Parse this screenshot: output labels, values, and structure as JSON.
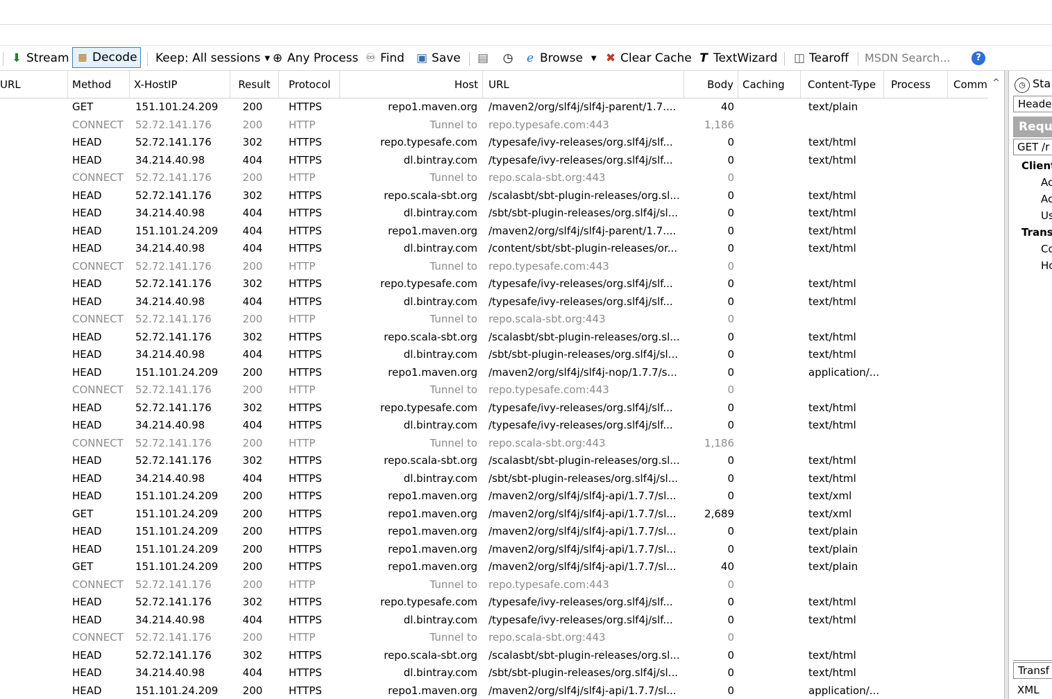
{
  "toolbar": {
    "stream": "Stream",
    "decode": "Decode",
    "keep": "Keep: All sessions",
    "any_process": "Any Process",
    "find": "Find",
    "save": "Save",
    "browse": "Browse",
    "clear_cache": "Clear Cache",
    "textwizard": "TextWizard",
    "tearoff": "Tearoff",
    "msdn_search": "MSDN Search..."
  },
  "columns": {
    "url_left": "URL",
    "method": "Method",
    "xhostip": "X-HostIP",
    "result": "Result",
    "protocol": "Protocol",
    "host": "Host",
    "url": "URL",
    "body": "Body",
    "caching": "Caching",
    "content_type": "Content-Type",
    "process": "Process",
    "comments": "Comm"
  },
  "rows": [
    {
      "method": "GET",
      "xhost": "151.101.24.209",
      "result": "200",
      "protocol": "HTTPS",
      "host": "repo1.maven.org",
      "url": "/maven2/org/slf4j/slf4j-parent/1.7....",
      "body": "40",
      "ctype": "text/plain",
      "tunnel": false
    },
    {
      "method": "CONNECT",
      "xhost": "52.72.141.176",
      "result": "200",
      "protocol": "HTTP",
      "host": "Tunnel to",
      "url": "repo.typesafe.com:443",
      "body": "1,186",
      "ctype": "",
      "tunnel": true
    },
    {
      "method": "HEAD",
      "xhost": "52.72.141.176",
      "result": "302",
      "protocol": "HTTPS",
      "host": "repo.typesafe.com",
      "url": "/typesafe/ivy-releases/org.slf4j/slf...",
      "body": "0",
      "ctype": "text/html",
      "tunnel": false
    },
    {
      "method": "HEAD",
      "xhost": "34.214.40.98",
      "result": "404",
      "protocol": "HTTPS",
      "host": "dl.bintray.com",
      "url": "/typesafe/ivy-releases/org.slf4j/slf...",
      "body": "0",
      "ctype": "text/html",
      "tunnel": false
    },
    {
      "method": "CONNECT",
      "xhost": "52.72.141.176",
      "result": "200",
      "protocol": "HTTP",
      "host": "Tunnel to",
      "url": "repo.scala-sbt.org:443",
      "body": "0",
      "ctype": "",
      "tunnel": true
    },
    {
      "method": "HEAD",
      "xhost": "52.72.141.176",
      "result": "302",
      "protocol": "HTTPS",
      "host": "repo.scala-sbt.org",
      "url": "/scalasbt/sbt-plugin-releases/org.sl...",
      "body": "0",
      "ctype": "text/html",
      "tunnel": false
    },
    {
      "method": "HEAD",
      "xhost": "34.214.40.98",
      "result": "404",
      "protocol": "HTTPS",
      "host": "dl.bintray.com",
      "url": "/sbt/sbt-plugin-releases/org.slf4j/sl...",
      "body": "0",
      "ctype": "text/html",
      "tunnel": false
    },
    {
      "method": "HEAD",
      "xhost": "151.101.24.209",
      "result": "404",
      "protocol": "HTTPS",
      "host": "repo1.maven.org",
      "url": "/maven2/org/slf4j/slf4j-parent/1.7....",
      "body": "0",
      "ctype": "text/html",
      "tunnel": false
    },
    {
      "method": "HEAD",
      "xhost": "34.214.40.98",
      "result": "404",
      "protocol": "HTTPS",
      "host": "dl.bintray.com",
      "url": "/content/sbt/sbt-plugin-releases/or...",
      "body": "0",
      "ctype": "text/html",
      "tunnel": false
    },
    {
      "method": "CONNECT",
      "xhost": "52.72.141.176",
      "result": "200",
      "protocol": "HTTP",
      "host": "Tunnel to",
      "url": "repo.typesafe.com:443",
      "body": "0",
      "ctype": "",
      "tunnel": true
    },
    {
      "method": "HEAD",
      "xhost": "52.72.141.176",
      "result": "302",
      "protocol": "HTTPS",
      "host": "repo.typesafe.com",
      "url": "/typesafe/ivy-releases/org.slf4j/slf...",
      "body": "0",
      "ctype": "text/html",
      "tunnel": false
    },
    {
      "method": "HEAD",
      "xhost": "34.214.40.98",
      "result": "404",
      "protocol": "HTTPS",
      "host": "dl.bintray.com",
      "url": "/typesafe/ivy-releases/org.slf4j/slf...",
      "body": "0",
      "ctype": "text/html",
      "tunnel": false
    },
    {
      "method": "CONNECT",
      "xhost": "52.72.141.176",
      "result": "200",
      "protocol": "HTTP",
      "host": "Tunnel to",
      "url": "repo.scala-sbt.org:443",
      "body": "0",
      "ctype": "",
      "tunnel": true
    },
    {
      "method": "HEAD",
      "xhost": "52.72.141.176",
      "result": "302",
      "protocol": "HTTPS",
      "host": "repo.scala-sbt.org",
      "url": "/scalasbt/sbt-plugin-releases/org.sl...",
      "body": "0",
      "ctype": "text/html",
      "tunnel": false
    },
    {
      "method": "HEAD",
      "xhost": "34.214.40.98",
      "result": "404",
      "protocol": "HTTPS",
      "host": "dl.bintray.com",
      "url": "/sbt/sbt-plugin-releases/org.slf4j/sl...",
      "body": "0",
      "ctype": "text/html",
      "tunnel": false
    },
    {
      "method": "HEAD",
      "xhost": "151.101.24.209",
      "result": "200",
      "protocol": "HTTPS",
      "host": "repo1.maven.org",
      "url": "/maven2/org/slf4j/slf4j-nop/1.7.7/s...",
      "body": "0",
      "ctype": "application/...",
      "tunnel": false
    },
    {
      "method": "CONNECT",
      "xhost": "52.72.141.176",
      "result": "200",
      "protocol": "HTTP",
      "host": "Tunnel to",
      "url": "repo.typesafe.com:443",
      "body": "0",
      "ctype": "",
      "tunnel": true
    },
    {
      "method": "HEAD",
      "xhost": "52.72.141.176",
      "result": "302",
      "protocol": "HTTPS",
      "host": "repo.typesafe.com",
      "url": "/typesafe/ivy-releases/org.slf4j/slf...",
      "body": "0",
      "ctype": "text/html",
      "tunnel": false
    },
    {
      "method": "HEAD",
      "xhost": "34.214.40.98",
      "result": "404",
      "protocol": "HTTPS",
      "host": "dl.bintray.com",
      "url": "/typesafe/ivy-releases/org.slf4j/slf...",
      "body": "0",
      "ctype": "text/html",
      "tunnel": false
    },
    {
      "method": "CONNECT",
      "xhost": "52.72.141.176",
      "result": "200",
      "protocol": "HTTP",
      "host": "Tunnel to",
      "url": "repo.scala-sbt.org:443",
      "body": "1,186",
      "ctype": "",
      "tunnel": true
    },
    {
      "method": "HEAD",
      "xhost": "52.72.141.176",
      "result": "302",
      "protocol": "HTTPS",
      "host": "repo.scala-sbt.org",
      "url": "/scalasbt/sbt-plugin-releases/org.sl...",
      "body": "0",
      "ctype": "text/html",
      "tunnel": false
    },
    {
      "method": "HEAD",
      "xhost": "34.214.40.98",
      "result": "404",
      "protocol": "HTTPS",
      "host": "dl.bintray.com",
      "url": "/sbt/sbt-plugin-releases/org.slf4j/sl...",
      "body": "0",
      "ctype": "text/html",
      "tunnel": false
    },
    {
      "method": "HEAD",
      "xhost": "151.101.24.209",
      "result": "200",
      "protocol": "HTTPS",
      "host": "repo1.maven.org",
      "url": "/maven2/org/slf4j/slf4j-api/1.7.7/sl...",
      "body": "0",
      "ctype": "text/xml",
      "tunnel": false
    },
    {
      "method": "GET",
      "xhost": "151.101.24.209",
      "result": "200",
      "protocol": "HTTPS",
      "host": "repo1.maven.org",
      "url": "/maven2/org/slf4j/slf4j-api/1.7.7/sl...",
      "body": "2,689",
      "ctype": "text/xml",
      "tunnel": false
    },
    {
      "method": "HEAD",
      "xhost": "151.101.24.209",
      "result": "200",
      "protocol": "HTTPS",
      "host": "repo1.maven.org",
      "url": "/maven2/org/slf4j/slf4j-api/1.7.7/sl...",
      "body": "0",
      "ctype": "text/plain",
      "tunnel": false
    },
    {
      "method": "HEAD",
      "xhost": "151.101.24.209",
      "result": "200",
      "protocol": "HTTPS",
      "host": "repo1.maven.org",
      "url": "/maven2/org/slf4j/slf4j-api/1.7.7/sl...",
      "body": "0",
      "ctype": "text/plain",
      "tunnel": false
    },
    {
      "method": "GET",
      "xhost": "151.101.24.209",
      "result": "200",
      "protocol": "HTTPS",
      "host": "repo1.maven.org",
      "url": "/maven2/org/slf4j/slf4j-api/1.7.7/sl...",
      "body": "40",
      "ctype": "text/plain",
      "tunnel": false
    },
    {
      "method": "CONNECT",
      "xhost": "52.72.141.176",
      "result": "200",
      "protocol": "HTTP",
      "host": "Tunnel to",
      "url": "repo.typesafe.com:443",
      "body": "0",
      "ctype": "",
      "tunnel": true
    },
    {
      "method": "HEAD",
      "xhost": "52.72.141.176",
      "result": "302",
      "protocol": "HTTPS",
      "host": "repo.typesafe.com",
      "url": "/typesafe/ivy-releases/org.slf4j/slf...",
      "body": "0",
      "ctype": "text/html",
      "tunnel": false
    },
    {
      "method": "HEAD",
      "xhost": "34.214.40.98",
      "result": "404",
      "protocol": "HTTPS",
      "host": "dl.bintray.com",
      "url": "/typesafe/ivy-releases/org.slf4j/slf...",
      "body": "0",
      "ctype": "text/html",
      "tunnel": false
    },
    {
      "method": "CONNECT",
      "xhost": "52.72.141.176",
      "result": "200",
      "protocol": "HTTP",
      "host": "Tunnel to",
      "url": "repo.scala-sbt.org:443",
      "body": "0",
      "ctype": "",
      "tunnel": true
    },
    {
      "method": "HEAD",
      "xhost": "52.72.141.176",
      "result": "302",
      "protocol": "HTTPS",
      "host": "repo.scala-sbt.org",
      "url": "/scalasbt/sbt-plugin-releases/org.sl...",
      "body": "0",
      "ctype": "text/html",
      "tunnel": false
    },
    {
      "method": "HEAD",
      "xhost": "34.214.40.98",
      "result": "404",
      "protocol": "HTTPS",
      "host": "dl.bintray.com",
      "url": "/sbt/sbt-plugin-releases/org.slf4j/sl...",
      "body": "0",
      "ctype": "text/html",
      "tunnel": false
    },
    {
      "method": "HEAD",
      "xhost": "151.101.24.209",
      "result": "200",
      "protocol": "HTTPS",
      "host": "repo1.maven.org",
      "url": "/maven2/org/slf4j/slf4j-api/1.7.7/sl...",
      "body": "0",
      "ctype": "application/...",
      "tunnel": false
    }
  ],
  "right_panel": {
    "tab": "Sta",
    "headers_tab": "Header",
    "request_label": "Requ",
    "request_line": "GET /r",
    "section_client": "Client",
    "client_items": [
      "Ac",
      "Ac",
      "Us"
    ],
    "section_transport": "Trans",
    "transport_items": [
      "Co",
      "Ho"
    ],
    "transformer_tab": "Transf",
    "xml_tab": "XML"
  },
  "colors": {
    "tunnel_text": "#8c8c8c",
    "decode_border": "#3c7fb1",
    "help_icon": "#2f6fd6"
  }
}
